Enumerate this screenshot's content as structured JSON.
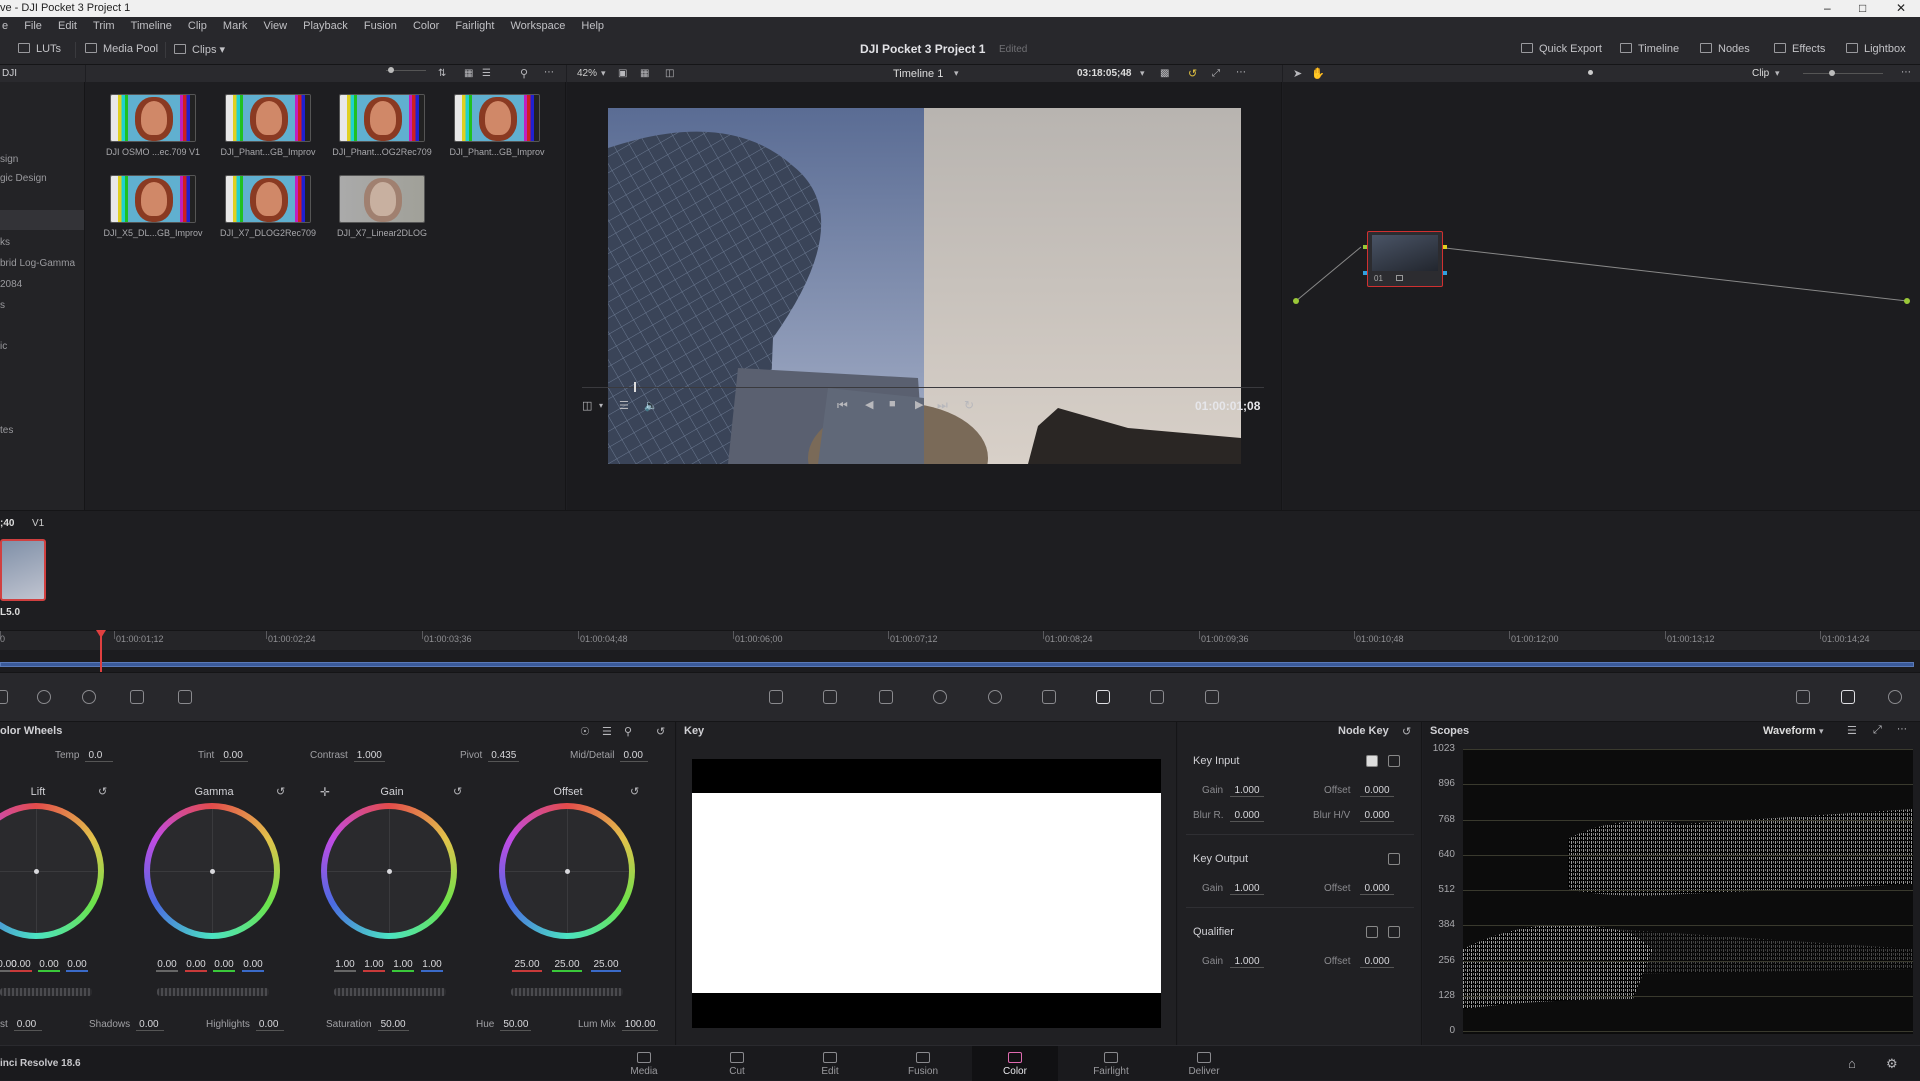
{
  "window": {
    "title": "ve - DJI Pocket 3 Project 1"
  },
  "menu": [
    "e",
    "File",
    "Edit",
    "Trim",
    "Timeline",
    "Clip",
    "Mark",
    "View",
    "Playback",
    "Fusion",
    "Color",
    "Fairlight",
    "Workspace",
    "Help"
  ],
  "toolbar": {
    "luts": "LUTs",
    "media_pool": "Media Pool",
    "clips": "Clips",
    "project_title": "DJI Pocket 3 Project 1",
    "edited": "Edited",
    "quick_export": "Quick Export",
    "timeline": "Timeline",
    "nodes": "Nodes",
    "effects": "Effects",
    "lightbox": "Lightbox"
  },
  "lut_sidebar": {
    "header": "DJI",
    "items": [
      "sign",
      "gic Design",
      "ks",
      "brid Log-Gamma",
      "2084",
      "s",
      "ic",
      "tes"
    ]
  },
  "lut_grid": {
    "items": [
      {
        "label": "DJI OSMO ...ec.709 V1"
      },
      {
        "label": "DJI_Phant...GB_Improv"
      },
      {
        "label": "DJI_Phant...OG2Rec709"
      },
      {
        "label": "DJI_Phant...GB_Improv"
      },
      {
        "label": "DJI_X5_DL...GB_Improv"
      },
      {
        "label": "DJI_X7_DLOG2Rec709"
      },
      {
        "label": "DJI_X7_Linear2DLOG"
      }
    ]
  },
  "viewer": {
    "zoom": "42%",
    "timeline_name": "Timeline 1",
    "timecode_top": "03:18:05;48",
    "timecode": "01:00:01;08"
  },
  "nodes": {
    "clip_mode": "Clip",
    "node_label": "01"
  },
  "timeline_strip": {
    "clip_tc": ";40",
    "track": "V1",
    "clip_name": "L5.0"
  },
  "ruler": [
    "0",
    "01:00:01;12",
    "01:00:02;24",
    "01:00:03;36",
    "01:00:04;48",
    "01:00:06;00",
    "01:00:07;12",
    "01:00:08;24",
    "01:00:09;36",
    "01:00:10;48",
    "01:00:12;00",
    "01:00:13;12",
    "01:00:14;24"
  ],
  "color_wheels": {
    "title": "olor Wheels",
    "temp_label": "Temp",
    "temp": "0.0",
    "tint_label": "Tint",
    "tint": "0.00",
    "contrast_label": "Contrast",
    "contrast": "1.000",
    "pivot_label": "Pivot",
    "pivot": "0.435",
    "mid_label": "Mid/Detail",
    "mid": "0.00",
    "wheels": [
      {
        "name": "Lift",
        "values": [
          "0.00",
          "0.00",
          "0.00",
          "0.00"
        ]
      },
      {
        "name": "Gamma",
        "values": [
          "0.00",
          "0.00",
          "0.00",
          "0.00"
        ]
      },
      {
        "name": "Gain",
        "values": [
          "1.00",
          "1.00",
          "1.00",
          "1.00"
        ]
      },
      {
        "name": "Offset",
        "values": [
          "25.00",
          "25.00",
          "25.00"
        ]
      }
    ],
    "bottom": {
      "boost_label": "st",
      "boost": "0.00",
      "shadows_label": "Shadows",
      "shadows": "0.00",
      "highlights_label": "Highlights",
      "highlights": "0.00",
      "saturation_label": "Saturation",
      "saturation": "50.00",
      "hue_label": "Hue",
      "hue": "50.00",
      "lummix_label": "Lum Mix",
      "lummix": "100.00"
    }
  },
  "key": {
    "title": "Key"
  },
  "node_key": {
    "title": "Node Key",
    "key_input": "Key Input",
    "key_output": "Key Output",
    "qualifier": "Qualifier",
    "gain_label": "Gain",
    "offset_label": "Offset",
    "blur_r_label": "Blur R.",
    "blur_hv_label": "Blur H/V",
    "ki_gain": "1.000",
    "ki_offset": "0.000",
    "ki_blur_r": "0.000",
    "ki_blur_hv": "0.000",
    "ko_gain": "1.000",
    "ko_offset": "0.000",
    "q_gain": "1.000",
    "q_offset": "0.000"
  },
  "scopes": {
    "title": "Scopes",
    "mode": "Waveform",
    "levels": [
      "1023",
      "896",
      "768",
      "640",
      "512",
      "384",
      "256",
      "128",
      "0"
    ]
  },
  "pages": [
    "Media",
    "Cut",
    "Edit",
    "Fusion",
    "Color",
    "Fairlight",
    "Deliver"
  ],
  "version": "inci Resolve 18.6"
}
